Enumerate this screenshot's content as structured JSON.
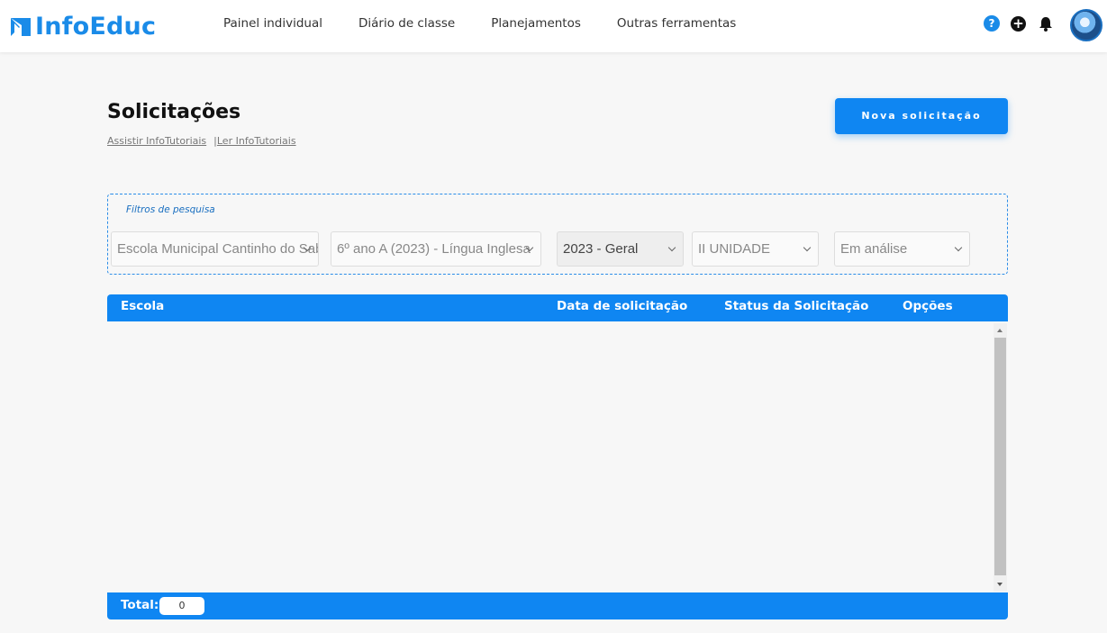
{
  "app": {
    "logo_text": "InfoEduc",
    "accent_color": "#0f86f2"
  },
  "nav": {
    "items": [
      "Painel individual",
      "Diário de classe",
      "Planejamentos",
      "Outras ferramentas"
    ],
    "icons": [
      "help-icon",
      "add-icon",
      "bell-icon",
      "avatar"
    ]
  },
  "header": {
    "title": "Solicitações",
    "link_watch": "Assistir InfoTutoriais",
    "link_sep": "|",
    "link_read": "Ler InfoTutoriais",
    "new_button": "Nova solicitação"
  },
  "filters": {
    "legend": "Filtros de pesquisa",
    "school": "Escola Municipal Cantinho do Saber",
    "class": "6º ano A (2023) - Língua Inglesa",
    "period": "2023 - Geral",
    "unit": "II UNIDADE",
    "status": "Em análise"
  },
  "table": {
    "columns": [
      "Escola",
      "Data de solicitação",
      "Status da Solicitação",
      "Opções"
    ],
    "rows": [],
    "total_label": "Total:",
    "total_value": "0"
  }
}
